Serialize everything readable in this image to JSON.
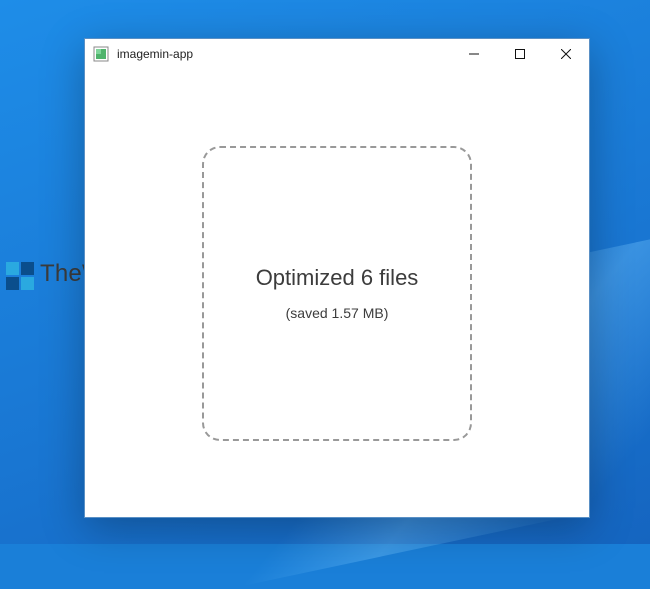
{
  "watermark": {
    "text": "TheWindowsClub"
  },
  "window": {
    "title": "imagemin-app"
  },
  "result": {
    "main": "Optimized 6 files",
    "sub": "(saved 1.57 MB)"
  }
}
